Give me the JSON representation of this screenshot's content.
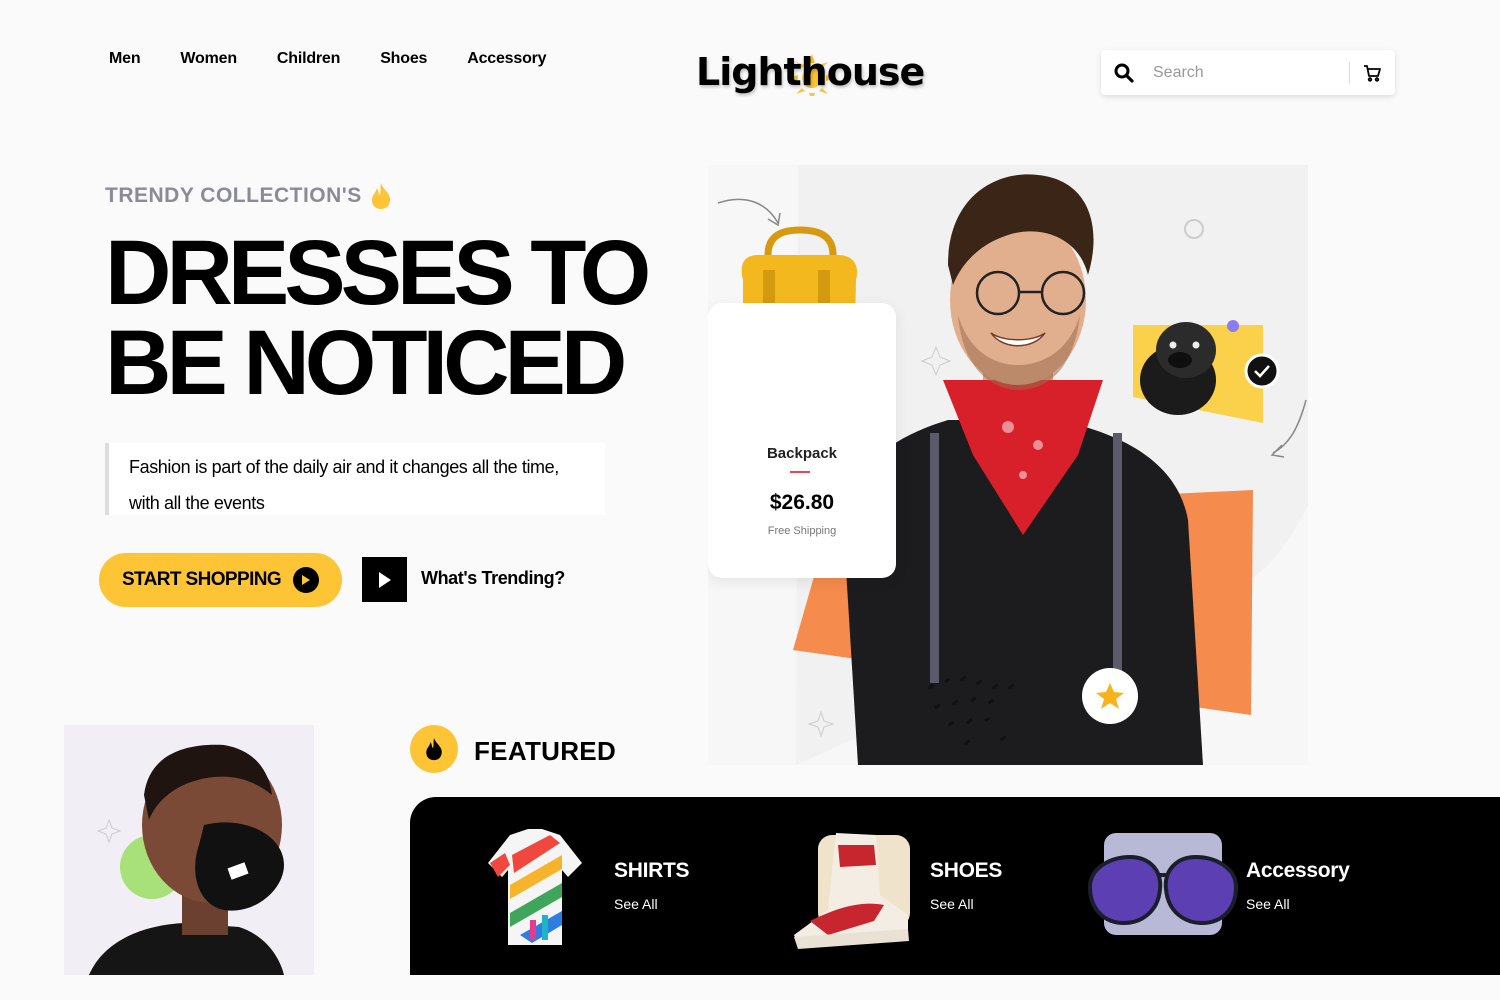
{
  "nav": {
    "items": [
      {
        "label": "Men"
      },
      {
        "label": "Women"
      },
      {
        "label": "Children"
      },
      {
        "label": "Shoes"
      },
      {
        "label": "Accessory"
      }
    ]
  },
  "brand": {
    "logo_text_a": "Light",
    "logo_text_b": "house"
  },
  "search": {
    "placeholder": "Search",
    "value": ""
  },
  "hero": {
    "kicker": "TRENDY COLLECTION'S",
    "headline_line1": "DRESSES TO",
    "headline_line2": "BE NOTICED",
    "quote_line1": "Fashion is part of the daily air and it changes all the time,",
    "quote_line2": "with all the events",
    "cta_label": "START SHOPPING",
    "video_label": "What's Trending?"
  },
  "product_card": {
    "name": "Backpack",
    "price": "$26.80",
    "shipping": "Free Shipping"
  },
  "featured": {
    "title": "FEATURED",
    "categories": [
      {
        "title": "SHIRTS",
        "link": "See All",
        "icon": "shirt-image"
      },
      {
        "title": "SHOES",
        "link": "See All",
        "icon": "shoe-image"
      },
      {
        "title": "Accessory",
        "link": "See All",
        "icon": "sunglasses-image"
      }
    ]
  },
  "colors": {
    "accent": "#fdc435",
    "orange": "#f58b4c",
    "text": "#000000",
    "muted": "#8b8b96",
    "dark": "#000000"
  }
}
